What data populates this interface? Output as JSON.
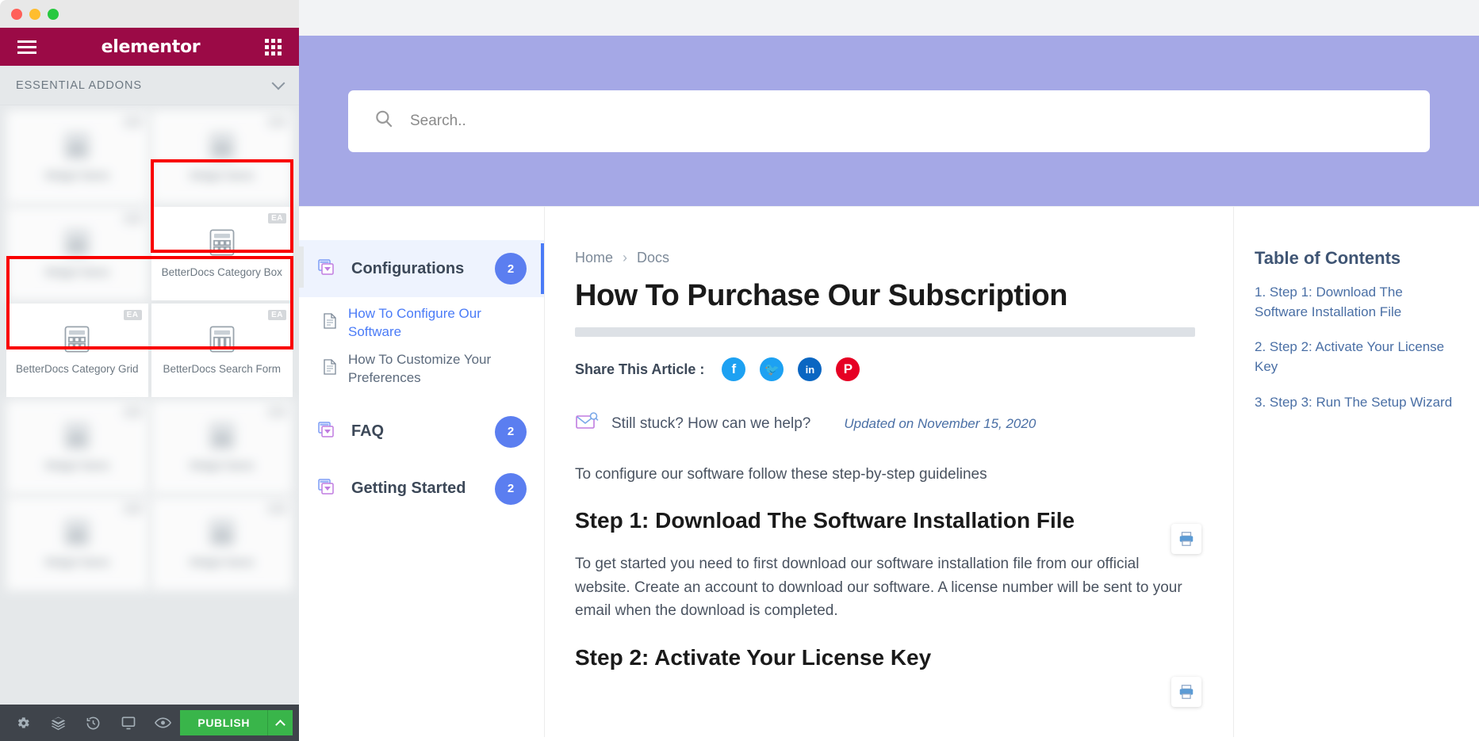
{
  "window": {
    "traffic_lights": [
      "close",
      "minimize",
      "maximize"
    ]
  },
  "elementor_panel": {
    "logo": "elementor",
    "menu_icon": "hamburger-icon",
    "grid_icon": "widgets-grid-icon",
    "section": {
      "title": "ESSENTIAL ADDONS",
      "collapse_icon": "chevron-down-icon"
    },
    "widgets": [
      {
        "label": "",
        "badge": "",
        "blurred": true
      },
      {
        "label": "",
        "badge": "",
        "blurred": true
      },
      {
        "label": "",
        "badge": "",
        "blurred": true
      },
      {
        "label": "BetterDocs Category Box",
        "badge": "EA",
        "blurred": false,
        "highlighted": true
      },
      {
        "label": "BetterDocs Category Grid",
        "badge": "EA",
        "blurred": false,
        "highlighted": true
      },
      {
        "label": "BetterDocs Search Form",
        "badge": "EA",
        "blurred": false,
        "highlighted": true
      },
      {
        "label": "",
        "badge": "",
        "blurred": true
      },
      {
        "label": "",
        "badge": "",
        "blurred": true
      },
      {
        "label": "",
        "badge": "",
        "blurred": true
      },
      {
        "label": "",
        "badge": "",
        "blurred": true
      }
    ],
    "footer": {
      "icons": [
        "settings-gear-icon",
        "navigator-layers-icon",
        "history-clock-icon",
        "responsive-monitor-icon",
        "preview-eye-icon"
      ],
      "publish_label": "PUBLISH",
      "publish_arrow_icon": "chevron-up-icon"
    }
  },
  "preview": {
    "search": {
      "placeholder": "Search..",
      "icon": "search-magnifier-icon",
      "hero_color": "#a5a8e6"
    },
    "categories": [
      {
        "name": "Configurations",
        "count": "2",
        "icon": "folder-docs-icon",
        "active": true,
        "docs": [
          {
            "title": "How To Configure Our Software",
            "icon": "document-icon",
            "linked": true
          },
          {
            "title": "How To Customize Your Preferences",
            "icon": "document-icon",
            "linked": false
          }
        ]
      },
      {
        "name": "FAQ",
        "count": "2",
        "icon": "folder-docs-icon",
        "active": false,
        "docs": []
      },
      {
        "name": "Getting Started",
        "count": "2",
        "icon": "folder-docs-icon",
        "active": false,
        "docs": []
      }
    ],
    "collapse_tab_icon": "chevron-left-icon",
    "article": {
      "breadcrumb": {
        "home": "Home",
        "separator": "›",
        "current": "Docs"
      },
      "title": "How To Purchase Our Subscription",
      "share_label": "Share This Article :",
      "share_buttons": [
        {
          "name": "facebook",
          "glyph": "f",
          "color": "#1da1f2"
        },
        {
          "name": "twitter",
          "glyph": "🐦",
          "color": "#1da1f2"
        },
        {
          "name": "linkedin",
          "glyph": "in",
          "color": "#0a66c2"
        },
        {
          "name": "pinterest",
          "glyph": "P",
          "color": "#e60023"
        }
      ],
      "help_text": "Still stuck? How can we help?",
      "help_icon": "envelope-search-icon",
      "updated": "Updated on November 15, 2020",
      "intro": "To configure our software follow these step-by-step guidelines",
      "step1_heading": "Step 1: Download The Software Installation File",
      "step1_body": "To get started you need to first download our software installation file from our official website. Create an account to download our software. A license number will be sent to your email when the download is completed.",
      "step2_heading": "Step 2: Activate Your License Key",
      "print_icon": "printer-icon"
    },
    "toc": {
      "title": "Table of Contents",
      "items": [
        "1. Step 1: Download The Software Installation File",
        "2. Step 2: Activate Your License Key",
        "3. Step 3: Run The Setup Wizard"
      ]
    }
  }
}
